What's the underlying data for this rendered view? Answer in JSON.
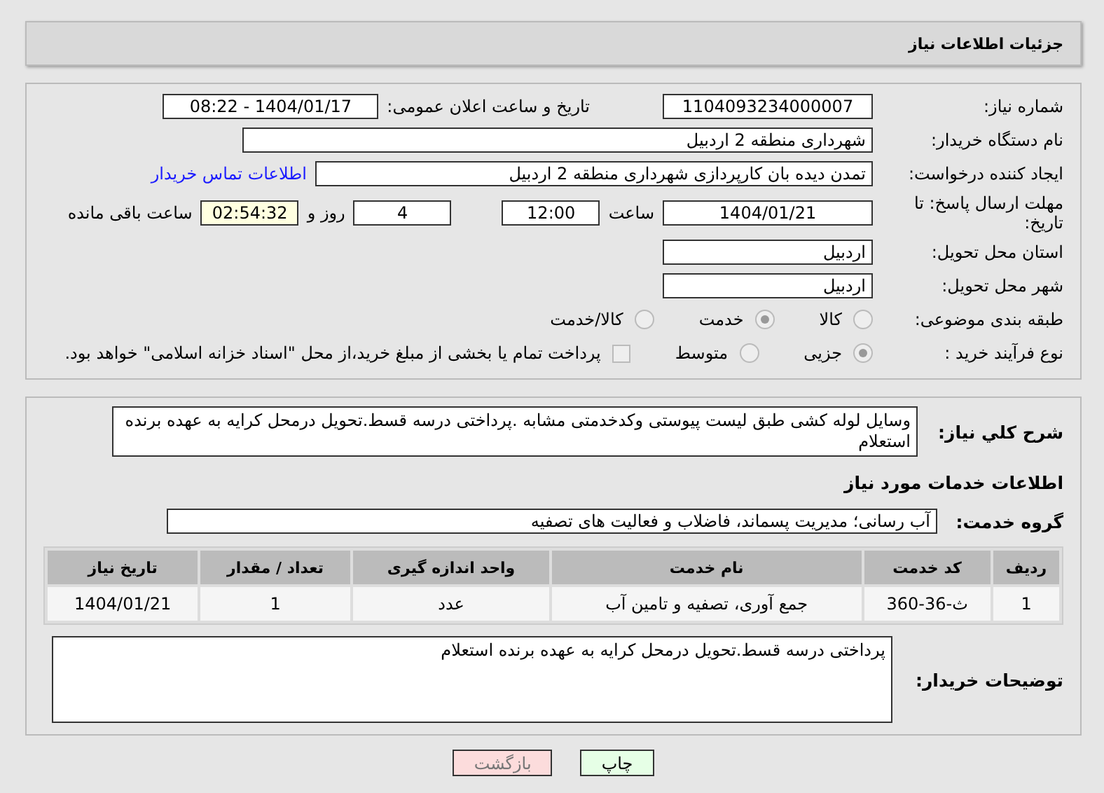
{
  "header": {
    "title": "جزئیات اطلاعات نیاز"
  },
  "need_number": {
    "label": "شماره نیاز:",
    "value": "1104093234000007"
  },
  "announce": {
    "label": "تاریخ و ساعت اعلان عمومی:",
    "value": "1404/01/17 - 08:22"
  },
  "buyer": {
    "label": "نام دستگاه خریدار:",
    "value": "شهرداری منطقه 2 اردبیل"
  },
  "creator": {
    "label": "ایجاد کننده درخواست:",
    "value": "تمدن دیده بان کارپردازی شهرداری منطقه 2 اردبیل",
    "link": "اطلاعات تماس خریدار"
  },
  "deadline": {
    "label": "مهلت ارسال پاسخ: تا تاریخ:",
    "date": "1404/01/21",
    "time_label": "ساعت",
    "time": "12:00",
    "days": "4",
    "days_label": "روز و",
    "remaining": "02:54:32",
    "remaining_label": "ساعت باقی مانده"
  },
  "province": {
    "label": "استان محل تحویل:",
    "value": "اردبیل"
  },
  "city": {
    "label": "شهر محل تحویل:",
    "value": "اردبیل"
  },
  "category": {
    "label": "طبقه بندی موضوعی:",
    "options": [
      {
        "label": "کالا",
        "selected": false
      },
      {
        "label": "خدمت",
        "selected": true
      },
      {
        "label": "کالا/خدمت",
        "selected": false
      }
    ]
  },
  "process": {
    "label": "نوع فرآیند خرید :",
    "options": [
      {
        "label": "جزیی",
        "selected": true
      },
      {
        "label": "متوسط",
        "selected": false
      }
    ],
    "payment": {
      "label": "پرداخت تمام یا بخشی از مبلغ خرید،از محل \"اسناد خزانه اسلامی\" خواهد بود.",
      "checked": false
    }
  },
  "description": {
    "label": "شرح کلي نياز:",
    "value": "وسایل لوله کشی طبق لیست پیوستی وکدخدمتی مشابه .پرداختی درسه قسط.تحویل درمحل کرایه به عهده برنده استعلام"
  },
  "services_title": "اطلاعات خدمات مورد نیاز",
  "service_group": {
    "label": "گروه خدمت:",
    "value": "آب رسانی؛ مدیریت پسماند، فاضلاب و فعالیت های تصفیه"
  },
  "table": {
    "columns": [
      "ردیف",
      "کد خدمت",
      "نام خدمت",
      "واحد اندازه گیری",
      "تعداد / مقدار",
      "تاریخ نیاز"
    ],
    "rows": [
      [
        "1",
        "ث-36-360",
        "جمع آوری، تصفیه و تامین آب",
        "عدد",
        "1",
        "1404/01/21"
      ]
    ]
  },
  "buyer_notes": {
    "label": "توضیحات خریدار:",
    "value": "پرداختی درسه قسط.تحویل درمحل کرایه به عهده برنده استعلام"
  },
  "buttons": [
    {
      "label": "چاپ",
      "kind": "print"
    },
    {
      "label": "بازگشت",
      "kind": "back"
    }
  ]
}
